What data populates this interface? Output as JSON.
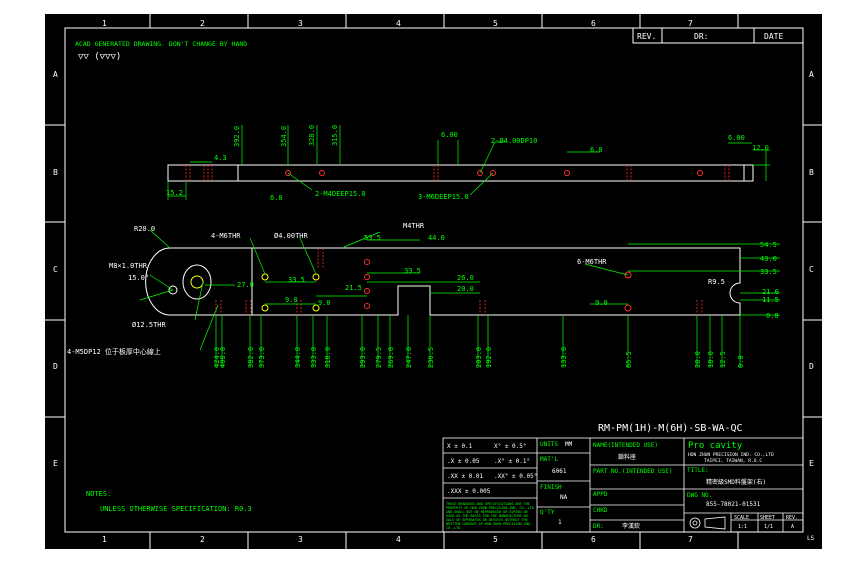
{
  "colors": {
    "background": "#000000",
    "frame": "#ffffff",
    "part": "#ffffff",
    "dimension": "#00ff00",
    "hidden": "#ff3030",
    "hole": "#ffff00",
    "title_text": "#00ff00",
    "page": "#ffffff"
  },
  "border": {
    "columns": [
      "1",
      "2",
      "3",
      "4",
      "5",
      "6",
      "7"
    ],
    "rows": [
      "A",
      "B",
      "C",
      "D",
      "E"
    ],
    "corner_mark": "LS"
  },
  "revision_block": {
    "rev": "REV.",
    "dr": "DR:",
    "date": "DATE"
  },
  "notes": {
    "header": "ACAD GENERATED DRAWING. DON'T CHANGE BY HAND",
    "finish_symbols": "▽▽ (▽▽▽)",
    "notes_label": "NOTES.",
    "notes_line": "UNLESS OTHERWISE SPECIFICATION: R0.3"
  },
  "top_view": {
    "dims": {
      "d392": "392.0",
      "d354": "354.0",
      "d328": "328.0",
      "d315": "315.0",
      "d43": "4.3",
      "d152": "15.2",
      "d60a": "6.0",
      "d60b": "6.00",
      "d60c": "6.0",
      "d60d": "6.00",
      "d120": "12.0"
    },
    "callouts": {
      "m4": "2-M4DEEP15.0",
      "dp10": "2-Ø4.00DP10",
      "m6": "3-M6DEEP15.0"
    }
  },
  "front_view": {
    "callouts": {
      "r20": "R20.0",
      "m6a": "4-M6THR",
      "phi4": "Ø4.00THR",
      "m4thr": "M4THR",
      "m8": "M8×1.0THR",
      "ang": "15.0°",
      "phi125": "Ø12.5THR",
      "m5": "4-M5DP12 位于板厚中心線上",
      "m6b": "6-M6THR",
      "r95": "R9.5"
    },
    "left_dims": {
      "d535": "53.5",
      "d440": "44.0",
      "d335a": "33.5",
      "d335b": "33.5",
      "d215": "21.5",
      "d260": "26.0",
      "d200": "20.0",
      "d270": "27.0",
      "d90a": "9.0",
      "d90b": "9.0",
      "d90c": "9.0"
    },
    "right_dims": {
      "d545": "54.5",
      "d430": "43.0",
      "d335": "33.5",
      "d210": "21.0",
      "d115": "11.5",
      "d00": "0.0"
    },
    "bottom_dims": [
      "424.0",
      "408.0",
      "382.0",
      "373.0",
      "344.0",
      "333.0",
      "318.0",
      "293.0",
      "279.5",
      "269.0",
      "247.0",
      "236.5",
      "203.0",
      "192.0",
      "133.0",
      "85.5",
      "28.0",
      "18.0",
      "12.5",
      "0.0"
    ]
  },
  "part_number": "RM-PM(1H)-M(6H)-SB-WA-QC",
  "title_block": {
    "tolerances": {
      "t1": "X ± 0.1",
      "t2": ".X ± 0.05",
      "t3": ".XX ± 0.01",
      "t4": ".XXX ± 0.005",
      "a1": "X° ± 0.5°",
      "a2": ".X° ± 0.1°",
      "a3": ".XX° ± 0.05°"
    },
    "units_label": "UNITS",
    "units_value": "MM",
    "matl_label": "MAT'L",
    "matl_value": "6061",
    "finish_label": "FINISH",
    "finish_value": "NA",
    "qty_label": "Q'TY",
    "qty_value": "1",
    "name_label": "NAME(INTENDED USE)",
    "name_value": "鎖料座",
    "partno_label": "PART NO.(INTENDED USE)",
    "appd_label": "APPD",
    "chkd_label": "CHKD",
    "dr_label": "DR:",
    "dr_value": "李漢欽",
    "company_brand": "Pro cavity",
    "company_name": "HON ZHUN PRECISION IND. CO.,LTD",
    "company_addr": "TAIPEI, TAIWAN, R.O.C",
    "title_label": "TITLE:",
    "title_value": "精密級SMD料盤架(右)",
    "dwg_label": "DWG NO.",
    "dwg_value": "855-78021-01531",
    "scale_label": "SCALE",
    "sheet_label": "SHEET",
    "rev_label": "REV.",
    "scale_value": "1:1",
    "sheet_value": "1/1",
    "rev_value": "A",
    "proprietary": "THESE DRAWINGS AND SPECIFICATIONS ARE THE PROPERTY OF HON ZHUN PRECISION IND. CO.,LTD AND SHALL NOT BE REPRODUCED OR COPIED OR USED AS THE BASIS FOR THE MANUFACTURE OR SALE OF APPARATUS OR DEVICES WITHOUT THE WRITTEN CONSENT OF HON ZHUN PRECISION IND. CO.,LTD"
  }
}
